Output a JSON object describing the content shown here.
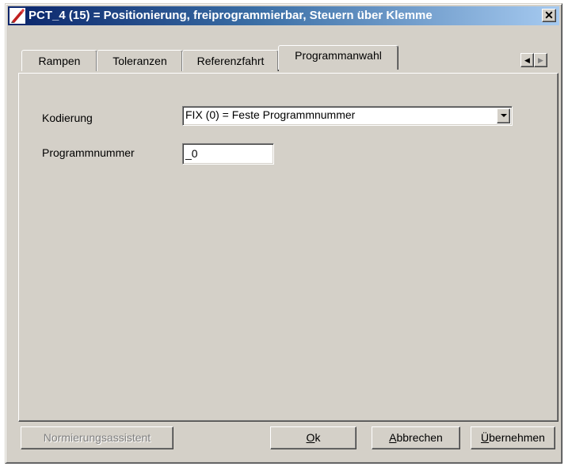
{
  "window": {
    "title": "PCT_4 (15) = Positionierung, freiprogrammierbar, Steuern über Klemme",
    "close_label": "✕"
  },
  "tabs": [
    {
      "label": "Rampen",
      "active": false
    },
    {
      "label": "Toleranzen",
      "active": false
    },
    {
      "label": "Referenzfahrt",
      "active": false
    },
    {
      "label": "Programmanwahl",
      "active": true
    }
  ],
  "tab_scroll": {
    "left": "◀",
    "right": "▶"
  },
  "form": {
    "kodierung_label": "Kodierung",
    "kodierung_value": "FIX (0) = Feste Programmnummer",
    "programmnummer_label": "Programmnummer",
    "programmnummer_value": "_0"
  },
  "buttons": {
    "normierung": "Normierungsassistent",
    "ok_mn": "O",
    "ok_rest": "k",
    "abbrechen_mn": "A",
    "abbrechen_rest": "bbrechen",
    "uebernehmen_mn": "Ü",
    "uebernehmen_rest": "bernehmen"
  },
  "colors": {
    "title_start": "#0a246a",
    "title_end": "#a6caf0",
    "face": "#d4d0c8"
  }
}
